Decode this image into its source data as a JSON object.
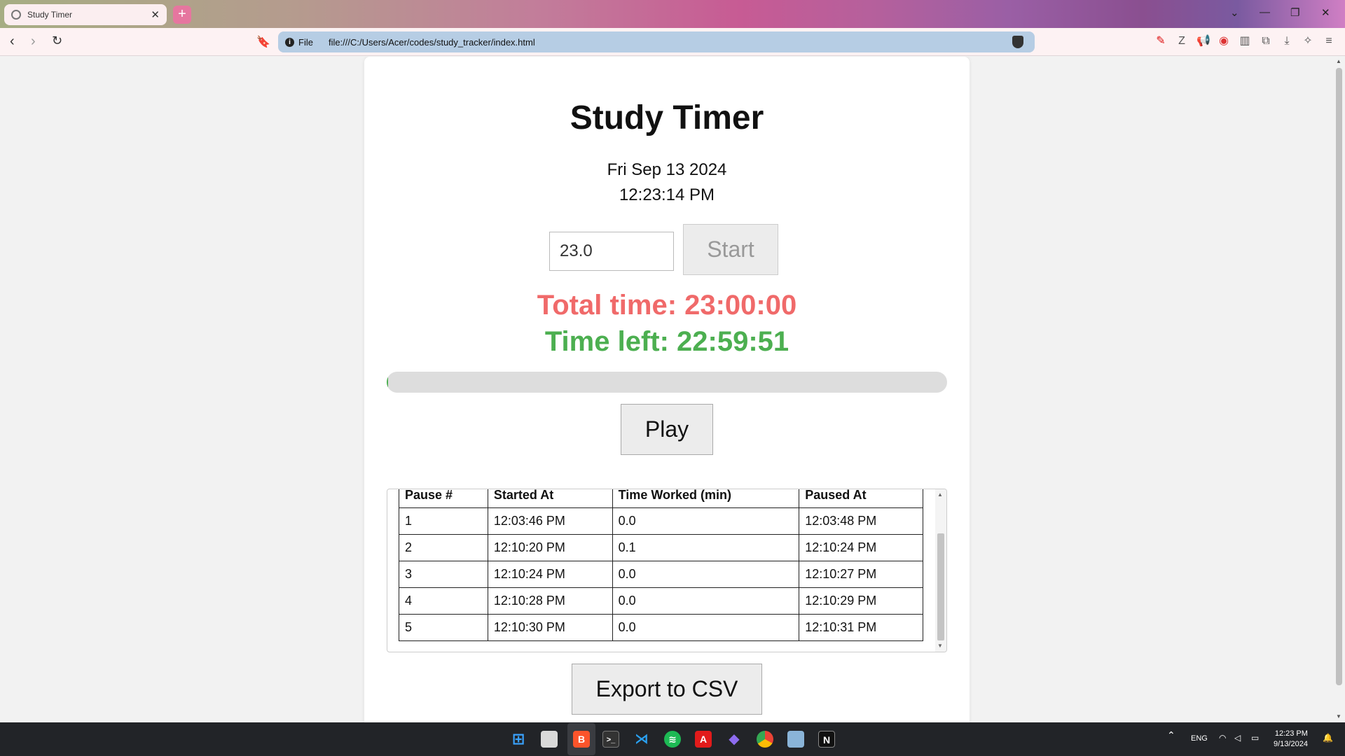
{
  "browser": {
    "tab_title": "Study Timer",
    "url_scheme_label": "File",
    "url": "file:///C:/Users/Acer/codes/study_tracker/index.html"
  },
  "page": {
    "title": "Study Timer",
    "date": "Fri Sep 13 2024",
    "clock": "12:23:14 PM",
    "hours_input_value": "23.0",
    "start_label": "Start",
    "total_time": "Total time: 23:00:00",
    "time_left": "Time left: 22:59:51",
    "progress_fraction": 0.0001,
    "play_label": "Play",
    "export_label": "Export to CSV"
  },
  "table": {
    "headers": [
      "Pause #",
      "Started At",
      "Time Worked (min)",
      "Paused At"
    ],
    "rows": [
      [
        "1",
        "12:03:46 PM",
        "0.0",
        "12:03:48 PM"
      ],
      [
        "2",
        "12:10:20 PM",
        "0.1",
        "12:10:24 PM"
      ],
      [
        "3",
        "12:10:24 PM",
        "0.0",
        "12:10:27 PM"
      ],
      [
        "4",
        "12:10:28 PM",
        "0.0",
        "12:10:29 PM"
      ],
      [
        "5",
        "12:10:30 PM",
        "0.0",
        "12:10:31 PM"
      ]
    ]
  },
  "colors": {
    "total_time": "#f06a6a",
    "time_left": "#4caf50",
    "progress_fill": "#4caf50"
  },
  "taskbar": {
    "language": "ENG",
    "time": "12:23 PM",
    "date": "9/13/2024",
    "icons": [
      "windows-start-icon",
      "file-explorer-icon",
      "brave-icon",
      "terminal-icon",
      "vscode-icon",
      "spotify-icon",
      "acrobat-icon",
      "obsidian-icon",
      "chrome-icon",
      "photos-icon",
      "notion-icon"
    ]
  }
}
